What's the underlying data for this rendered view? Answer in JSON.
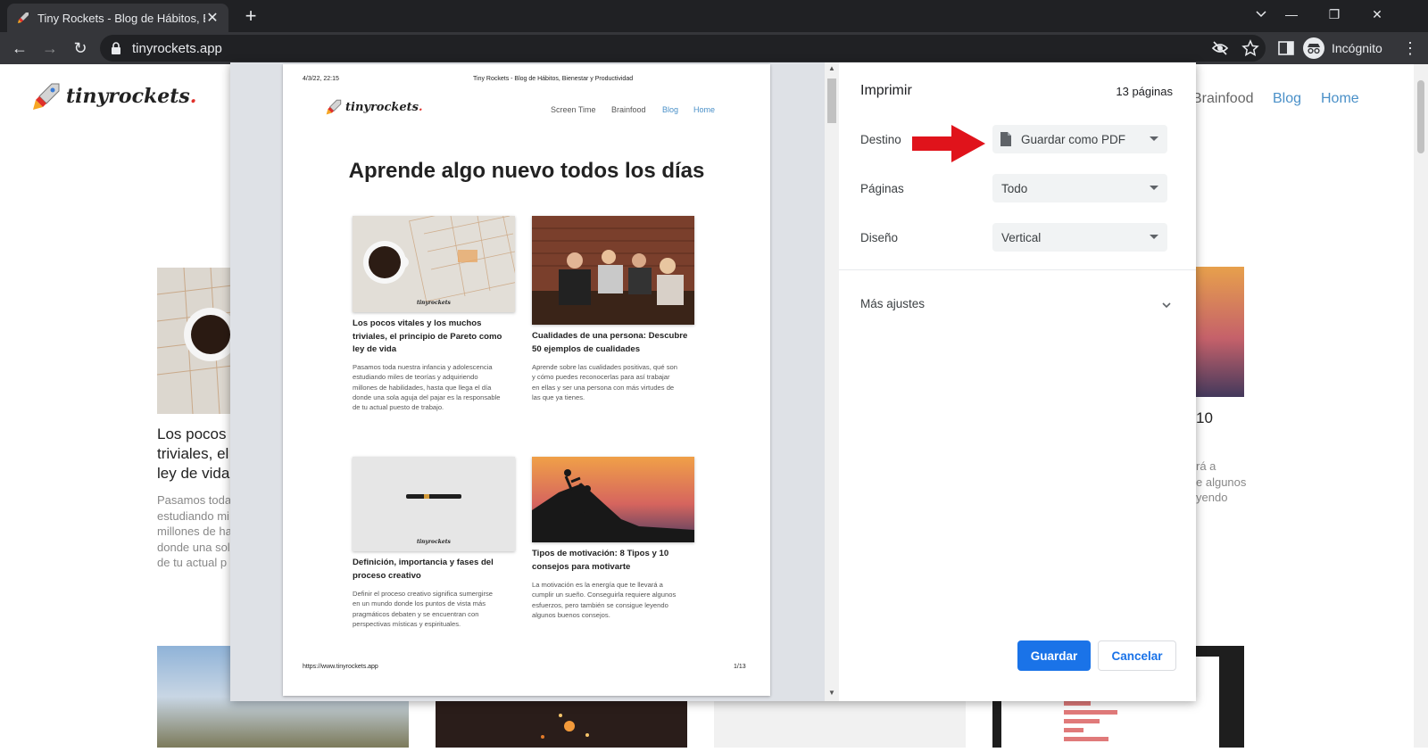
{
  "tab": {
    "title": "Tiny Rockets - Blog de Hábitos, B",
    "close": "✕"
  },
  "new_tab": "+",
  "window": {
    "minimize": "—",
    "restore": "❐",
    "close": "✕"
  },
  "toolbar": {
    "back": "←",
    "forward": "→",
    "reload": "↻",
    "url": "tinyrockets.app",
    "incognito": "Incógnito",
    "menu": "⋮"
  },
  "site": {
    "logo_text": "tinyrockets",
    "logo_dot": ".",
    "nav": [
      "Brainfood",
      "Blog",
      "Home"
    ],
    "bg_left": {
      "title": [
        "Los pocos v",
        "triviales, el",
        "ley de vida"
      ],
      "text": [
        "Pasamos toda",
        "estudiando mi",
        "millones de ha",
        "donde una sol",
        "de tu actual p"
      ]
    },
    "bg_right": {
      "title": "10",
      "text": [
        "rá a",
        "e algunos",
        "yendo"
      ]
    }
  },
  "preview": {
    "header_date": "4/3/22, 22:15",
    "header_title": "Tiny Rockets - Blog de Hábitos, Bienestar y Productividad",
    "logo_text": "tinyrockets",
    "logo_dot": ".",
    "nav": [
      "Screen Time",
      "Brainfood",
      "Blog",
      "Home"
    ],
    "heading": "Aprende algo nuevo todos los días",
    "img_logo": "tinyrockets",
    "cards": [
      {
        "title": [
          "Los pocos vitales y los muchos",
          "triviales, el principio de Pareto como",
          "ley de vida"
        ],
        "text": [
          "Pasamos toda nuestra infancia y adolescencia",
          "estudiando miles de teorías y adquiriendo",
          "millones de habilidades, hasta que llega el día",
          "donde una sola aguja del pajar es la responsable",
          "de tu actual puesto de trabajo."
        ]
      },
      {
        "title": [
          "Cualidades de una persona: Descubre",
          "50 ejemplos de cualidades"
        ],
        "text": [
          "Aprende sobre las cualidades positivas, qué son",
          "y cómo puedes reconocerlas para así trabajar",
          "en ellas y ser una persona con más virtudes de",
          "las que ya tienes."
        ]
      },
      {
        "title": [
          "Definición, importancia y fases del",
          "proceso creativo"
        ],
        "text": [
          "Definir el proceso creativo significa sumergirse",
          "en un mundo donde los puntos de vista más",
          "pragmáticos debaten y se encuentran con",
          "perspectivas místicas y espirituales."
        ]
      },
      {
        "title": [
          "Tipos de motivación: 8 Tipos y 10",
          "consejos para motivarte"
        ],
        "text": [
          "La motivación es la energía que te llevará a",
          "cumplir un sueño. Conseguirla requiere algunos",
          "esfuerzos, pero también se consigue leyendo",
          "algunos buenos consejos."
        ]
      }
    ],
    "footer_url": "https://www.tinyrockets.app",
    "footer_page": "1/13"
  },
  "print": {
    "title": "Imprimir",
    "page_count": "13 páginas",
    "destination_label": "Destino",
    "destination_value": "Guardar como PDF",
    "pages_label": "Páginas",
    "pages_value": "Todo",
    "layout_label": "Diseño",
    "layout_value": "Vertical",
    "more_settings": "Más ajustes",
    "save": "Guardar",
    "cancel": "Cancelar"
  },
  "colors": {
    "accent": "#1a73e8",
    "arrow": "#e0131b",
    "logo_dot": "#e0312b",
    "nav_link": "#4a90c8"
  }
}
